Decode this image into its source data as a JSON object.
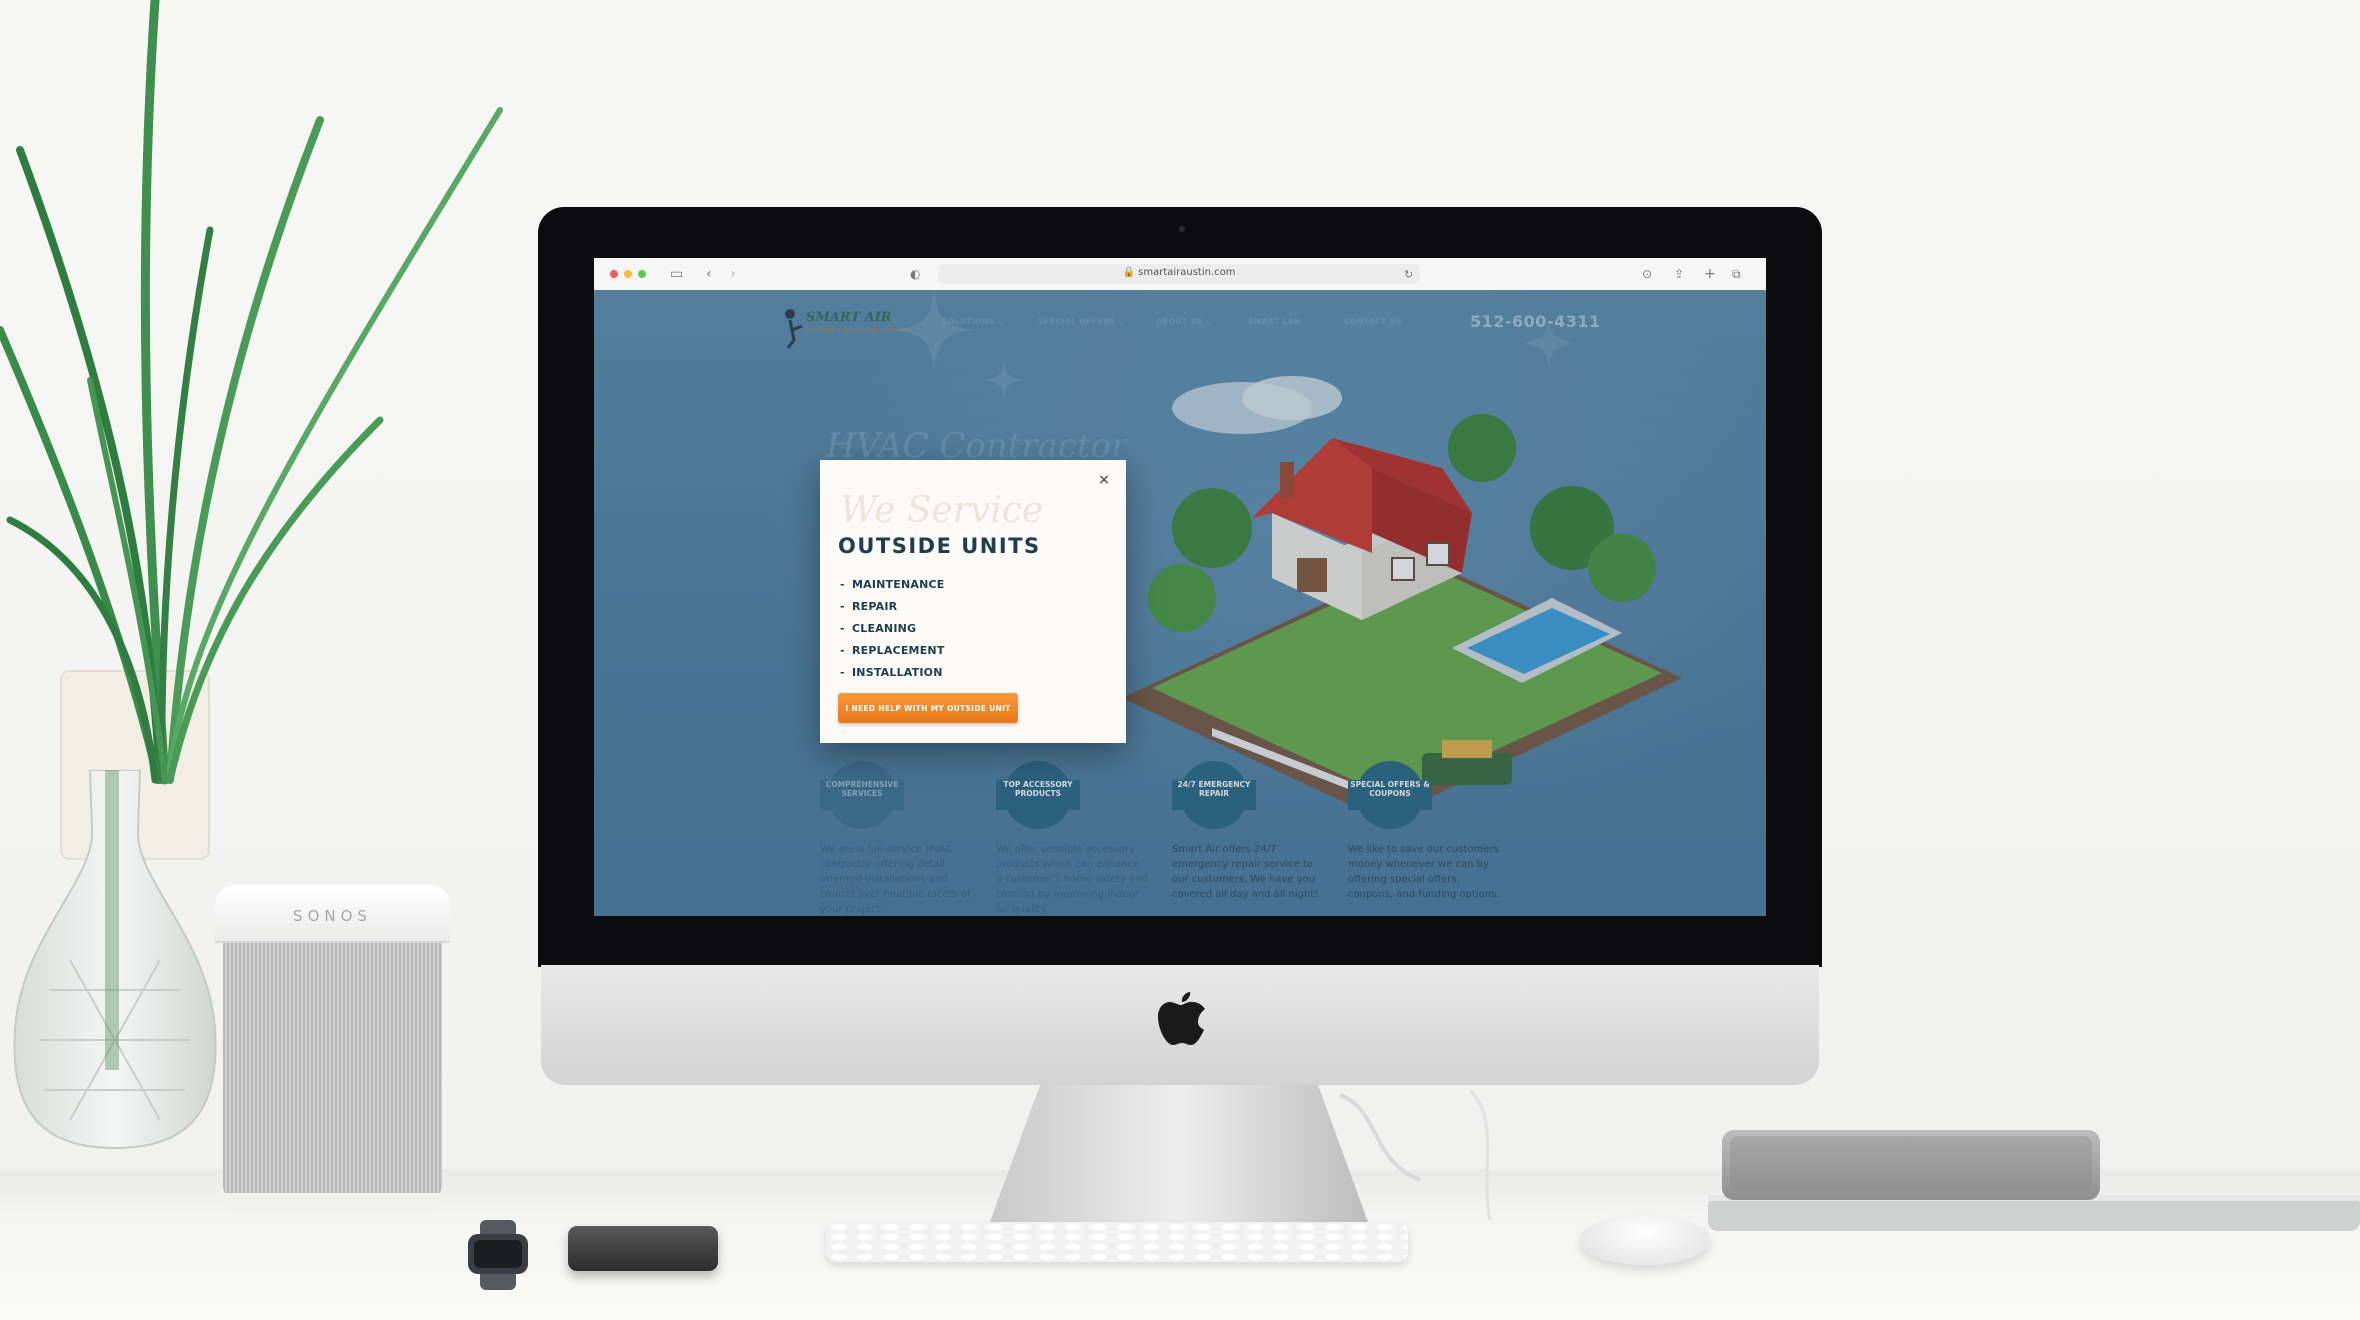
{
  "scene": {
    "speaker_brand": "SONOS"
  },
  "browser": {
    "url": "smartairaustin.com",
    "traffic_lights": [
      "#ee5f57",
      "#f6bd3b",
      "#5fc84c"
    ]
  },
  "site": {
    "logo_text": "SMART AIR",
    "logo_tagline": "HEATING & AIR CONDITIONING",
    "nav": [
      {
        "label": "SOLUTIONS",
        "has_dropdown": true
      },
      {
        "label": "SPECIAL OFFERS",
        "has_dropdown": true
      },
      {
        "label": "ABOUT US",
        "has_dropdown": true
      },
      {
        "label": "SMART LAB",
        "has_dropdown": true
      },
      {
        "label": "CONTACT US",
        "has_dropdown": false
      }
    ],
    "phone": "512-600-4311",
    "hero_script": "HVAC Contractor",
    "features": [
      {
        "badge": "COMPREHENSIVE SERVICES",
        "text": "We are a full-service HVAC contractor offering detail-oriented installations and control over multiple facets of your project."
      },
      {
        "badge": "TOP ACCESSORY PRODUCTS",
        "text": "We offer sensible accessory products which can enhance a customer's home safety and comfort by improving indoor air quality."
      },
      {
        "badge": "24/7 EMERGENCY REPAIR",
        "text": "Smart Air offers 24/7 emergency repair service to our customers. We have you covered all day and all night!"
      },
      {
        "badge": "SPECIAL OFFERS & COUPONS",
        "text": "We like to save our customers money whenever we can by offering special offers, coupons, and funding options."
      }
    ],
    "colors": {
      "page_bg": "#5583a4",
      "badge": "#2e6a86",
      "accent_orange": "#f28a2a",
      "heading": "#1f3d4e"
    }
  },
  "modal": {
    "close_label": "×",
    "script_heading": "We Service",
    "title": "OUTSIDE UNITS",
    "items": [
      "MAINTENANCE",
      "REPAIR",
      "CLEANING",
      "REPLACEMENT",
      "INSTALLATION"
    ],
    "cta": "I NEED HELP WITH MY OUTSIDE UNIT"
  }
}
